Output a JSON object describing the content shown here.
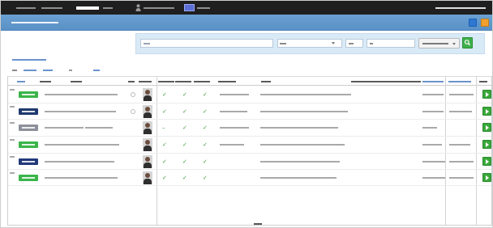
{
  "colors": {
    "nav_bg": "#1f1f1f",
    "title_bar": "#5f97cb",
    "search_panel": "#d9eaf7",
    "badge_green": "#3bb54a",
    "badge_navy": "#1f3a6e",
    "badge_grey": "#8d9099",
    "check": "#3f9a3a",
    "action_button": "#3aa83a",
    "toolbar_blue": "#2e78d2",
    "toolbar_orange": "#f0a030"
  },
  "nav": {
    "items": [
      "",
      "",
      "",
      "",
      "",
      ""
    ],
    "active_index": 2,
    "icons": [
      "person-icon",
      "app-icon"
    ],
    "user_label": ""
  },
  "title_bar": {
    "title": "",
    "icons": [
      "square-blue-icon",
      "square-orange-icon"
    ]
  },
  "search": {
    "query_placeholder": "",
    "select_value": "",
    "field_small": "",
    "field_wide": "",
    "button_label": "",
    "icon": "search-icon"
  },
  "filters": {
    "toggle_label": "",
    "links": [
      "",
      "",
      "",
      "",
      ""
    ]
  },
  "table": {
    "headers": [
      "",
      "",
      "",
      "",
      "",
      "",
      "",
      "",
      "",
      "",
      "",
      "",
      "",
      ""
    ],
    "rows": [
      {
        "id": "",
        "badge": {
          "label": "",
          "color": "#3bb54a"
        },
        "radio": true,
        "avatar": "person-photo",
        "name": "",
        "login": "",
        "checks": [
          "✓",
          "✓",
          "✓"
        ],
        "group": "",
        "email": "",
        "updated": "",
        "created": ""
      },
      {
        "id": "",
        "badge": {
          "label": "",
          "color": "#1f3a6e"
        },
        "radio": true,
        "avatar": "person-photo",
        "name": "",
        "login": "",
        "checks": [
          "✓",
          "✓",
          "✓"
        ],
        "group": "",
        "email": "",
        "updated": "",
        "created": ""
      },
      {
        "id": "",
        "badge": {
          "label": "",
          "color": "#8d9099"
        },
        "radio": false,
        "avatar": "person-photo",
        "name": "",
        "login": "",
        "checks": [
          "–",
          "✓",
          "✓"
        ],
        "group": "",
        "email": "",
        "updated": ""
      },
      {
        "id": "",
        "badge": {
          "label": "",
          "color": "#3bb54a"
        },
        "radio": false,
        "avatar": "person-photo",
        "name": "",
        "login": "",
        "checks": [
          "✓",
          "✓",
          "✓"
        ],
        "group": "",
        "email": "",
        "updated": "",
        "created": ""
      },
      {
        "id": "",
        "badge": {
          "label": "",
          "color": "#22397a"
        },
        "radio": false,
        "avatar": "person-photo",
        "name": "",
        "login": "",
        "checks": [
          "✓",
          "✓",
          "✓"
        ],
        "email": "",
        "updated": "",
        "created": ""
      },
      {
        "id": "",
        "badge": {
          "label": "",
          "color": "#3bb54a"
        },
        "radio": false,
        "avatar": "person-photo",
        "name": "",
        "login": "",
        "checks": [
          "✓",
          "✓",
          "✓"
        ],
        "email": "",
        "updated": "",
        "created": ""
      }
    ]
  },
  "pagination": {
    "label": ""
  }
}
